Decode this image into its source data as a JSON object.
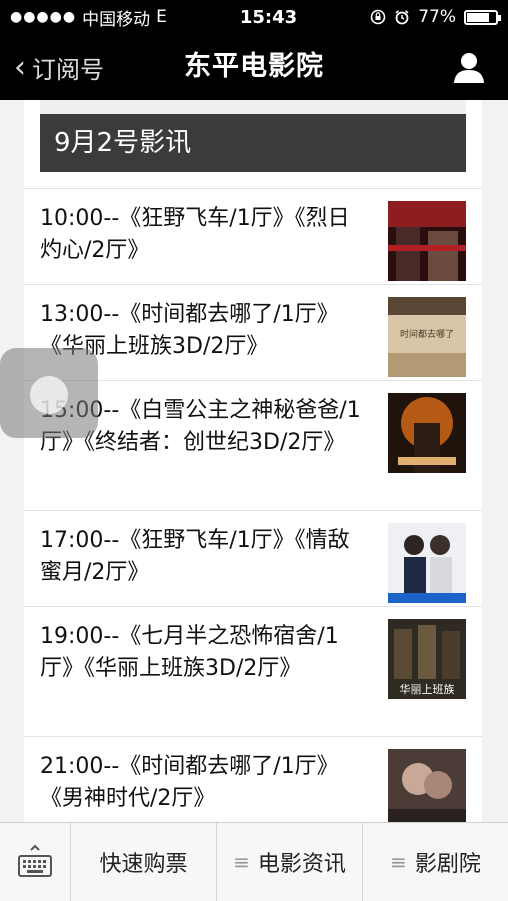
{
  "status_bar": {
    "carrier": "中国移动",
    "network": "E",
    "time": "15:43",
    "battery": "77%",
    "battery_level": 0.77
  },
  "nav": {
    "back_label": "订阅号",
    "title": "东平电影院"
  },
  "content": {
    "date_heading": "9月2号影讯",
    "showtimes": [
      {
        "text": "10:00--《狂野飞车/1厅》《烈日灼心/2厅》",
        "thumb_color": "#5a1b1d"
      },
      {
        "text": "13:00--《时间都去哪了/1厅》《华丽上班族3D/2厅》",
        "thumb_color": "#c6b08e",
        "thumb_caption": "时间都去哪了"
      },
      {
        "text": "15:00--《白雪公主之神秘爸爸/1厅》《终结者：创世纪3D/2厅》",
        "thumb_color": "#7a3b12"
      },
      {
        "text": "17:00--《狂野飞车/1厅》《情敌蜜月/2厅》",
        "thumb_color": "#e9e9ee"
      },
      {
        "text": "19:00--《七月半之恐怖宿舍/1厅》《华丽上班族3D/2厅》",
        "thumb_color": "#3a3328",
        "thumb_caption": "华丽上班族"
      },
      {
        "text": "21:00--《时间都去哪了/1厅》《男神时代/2厅》",
        "thumb_color": "#6d5a55"
      }
    ]
  },
  "bottom_menu": {
    "items": [
      "快速购票",
      "电影资讯",
      "影剧院"
    ]
  },
  "colors": {
    "bar_bg": "#000000",
    "banner_bg": "#3b3b3b"
  }
}
